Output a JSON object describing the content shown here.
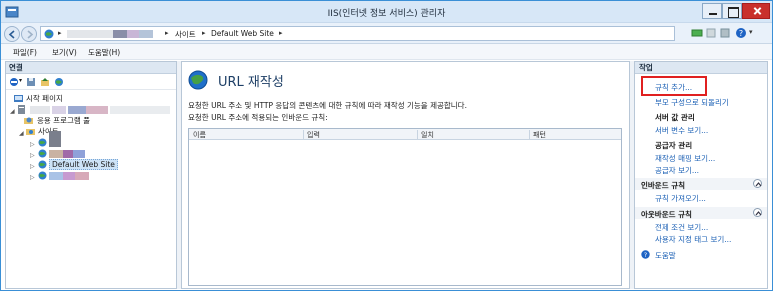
{
  "window": {
    "title": "IIS(인터넷 정보 서비스) 관리자"
  },
  "address": {
    "crumbs": [
      "사이트",
      "Default Web Site"
    ]
  },
  "menu": [
    "파일(F)",
    "보기(V)",
    "도움말(H)"
  ],
  "connections": {
    "header": "연결",
    "tree": [
      {
        "label": "시작 페이지",
        "icon": "home-icon"
      },
      {
        "label": "",
        "icon": "server-icon"
      },
      {
        "label": "응용 프로그램 풀",
        "icon": "app-pool-icon"
      },
      {
        "label": "사이트",
        "icon": "sites-folder-icon"
      },
      {
        "label": "",
        "icon": "site-globe-icon"
      },
      {
        "label": "",
        "icon": "site-globe-icon"
      },
      {
        "label": "Default Web Site",
        "icon": "site-globe-icon"
      },
      {
        "label": "",
        "icon": "site-globe-icon"
      }
    ]
  },
  "feature": {
    "title": "URL 재작성",
    "desc1": "요청한 URL 주소 및 HTTP 응답의 콘텐츠에 대한 규칙에 따라 재작성 기능을 제공합니다.",
    "desc2": "요청한 URL 주소에 적용되는 인바운드 규칙:",
    "columns": [
      "이름",
      "입력",
      "일치",
      "패턴"
    ]
  },
  "actions": {
    "header": "작업",
    "add_rule": "규칙 추가...",
    "revert_parent": "부모 구성으로 되돌리기",
    "server_vars_title": "서버 값 관리",
    "server_vars": "서버 변수 보기...",
    "provider_title": "공급자 관리",
    "rewrite_maps": "재작성 매핑 보기...",
    "providers": "공급자 보기...",
    "inbound_title": "인바운드 규칙",
    "import_rules": "규칙 가져오기...",
    "outbound_title": "아웃바운드 규칙",
    "preconditions": "전제 조건 보기...",
    "custom_tags": "사용자 지정 태그 보기...",
    "help": "도움말"
  },
  "colors": {
    "accent": "#1a5fb4",
    "highlight": "#e02020",
    "titlebar": "#d7e7f7"
  }
}
